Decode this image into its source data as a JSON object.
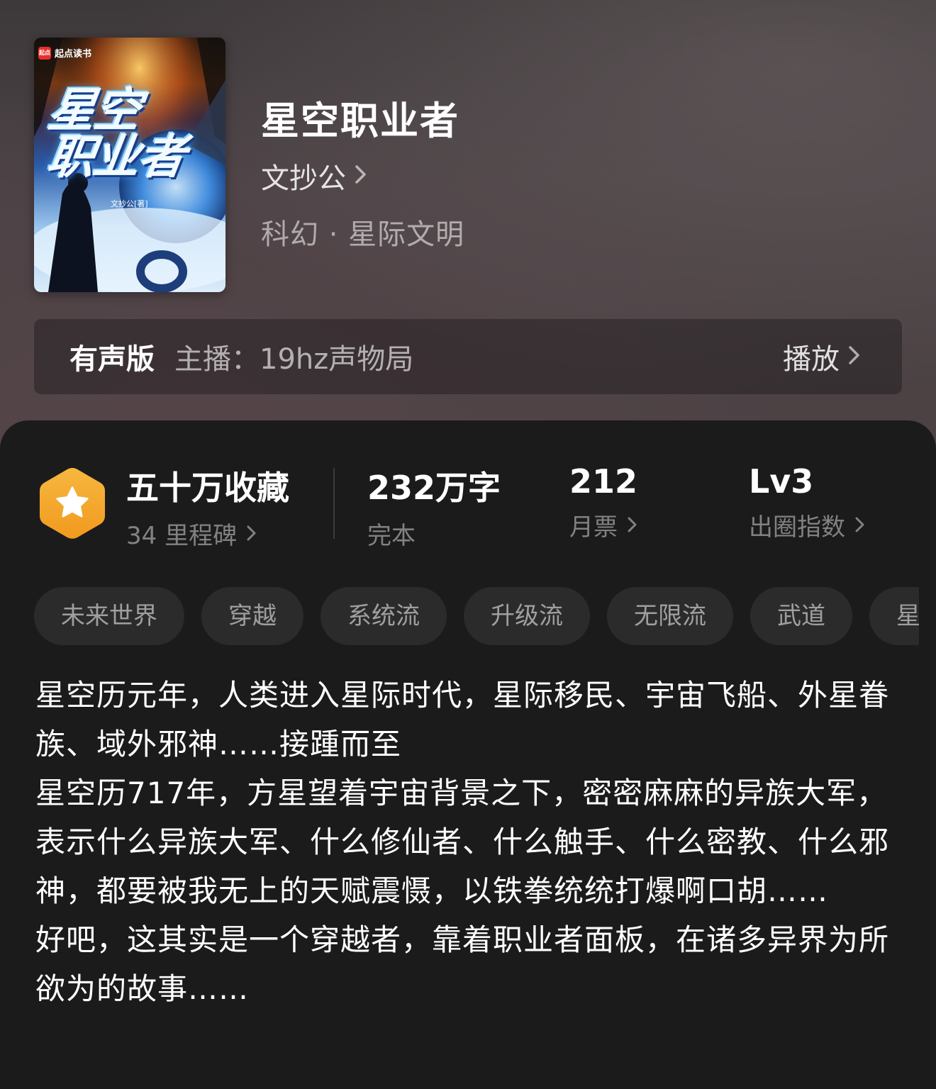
{
  "book": {
    "cover": {
      "brand": "起点读书",
      "brand_mark": "起点",
      "title_line1": "星空",
      "title_line2": "职业者",
      "author_credit": "文抄公[著]"
    },
    "title": "星空职业者",
    "author": "文抄公",
    "genre": "科幻 · 星际文明"
  },
  "audio": {
    "label": "有声版",
    "host": "主播：19hz声物局",
    "play_label": "播放"
  },
  "stats": {
    "collection": {
      "value": "五十万收藏",
      "sub": "34 里程碑"
    },
    "words": {
      "value": "232万字",
      "sub": "完本"
    },
    "monthly_tickets": {
      "value": "212",
      "sub": "月票"
    },
    "influence": {
      "value": "Lv3",
      "sub": "出圈指数"
    }
  },
  "tags": [
    "未来世界",
    "穿越",
    "系统流",
    "升级流",
    "无限流",
    "武道",
    "星"
  ],
  "description": [
    "星空历元年，人类进入星际时代，星际移民、宇宙飞船、外星眷族、域外邪神……接踵而至",
    "星空历717年，方星望着宇宙背景之下，密密麻麻的异族大军，表示什么异族大军、什么修仙者、什么触手、什么密教、什么邪神，都要被我无上的天赋震慑，以铁拳统统打爆啊口胡……",
    "好吧，这其实是一个穿越者，靠着职业者面板，在诸多异界为所欲为的故事……"
  ],
  "colors": {
    "panel_bg": "#1c1b1c",
    "tag_bg": "#2c2b2c",
    "badge_orange": "#f4ae33",
    "brand_red": "#e8312c"
  },
  "icons": {
    "chevron": "chevron-right-icon",
    "badge": "star-hexagon-icon"
  }
}
